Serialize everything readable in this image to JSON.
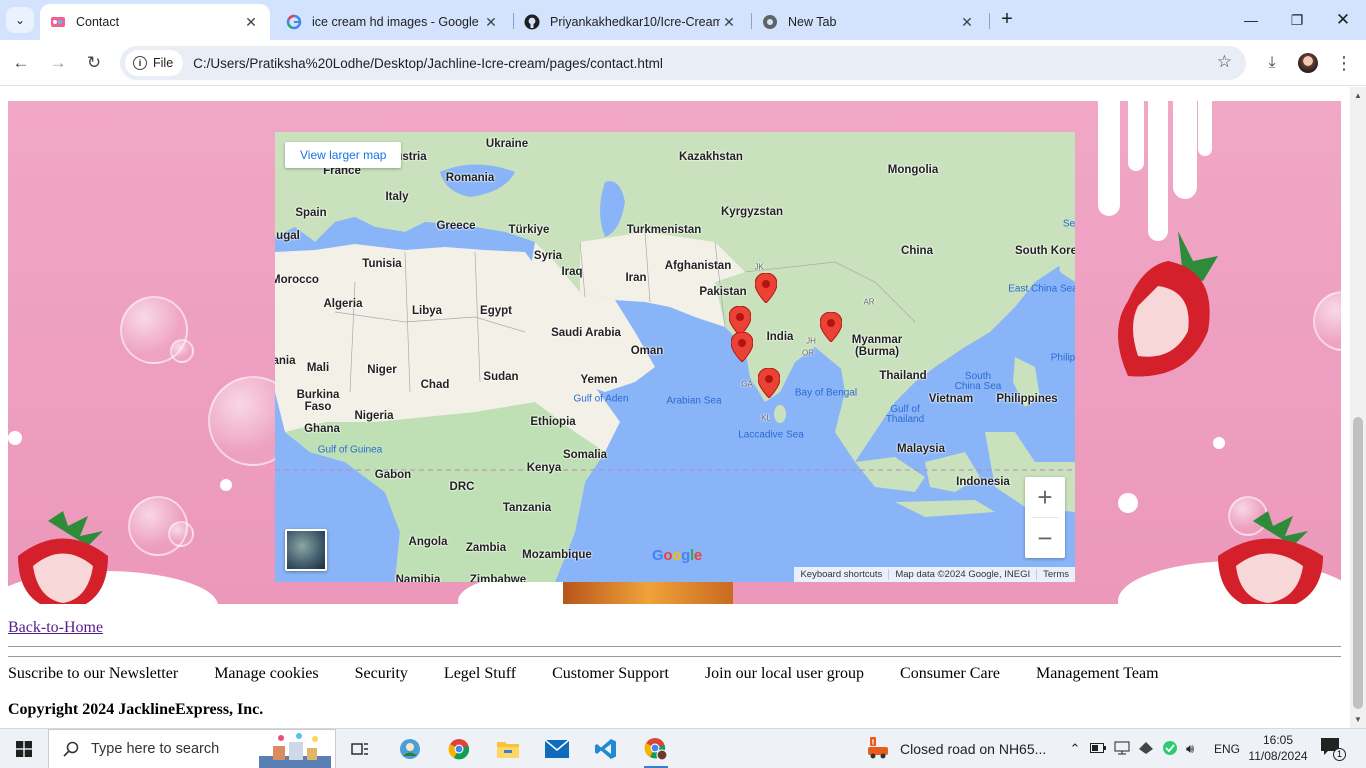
{
  "browser": {
    "tabs": [
      {
        "title": "Contact",
        "active": true
      },
      {
        "title": "ice cream hd images - Google S",
        "active": false
      },
      {
        "title": "Priyankakhedkar10/Icre-Cream",
        "active": false
      },
      {
        "title": "New Tab",
        "active": false
      }
    ],
    "file_chip": "File",
    "url": "C:/Users/Pratiksha%20Lodhe/Desktop/Jachline-Icre-cream/pages/contact.html"
  },
  "map": {
    "larger_map_label": "View larger map",
    "zoom_in": "+",
    "zoom_out": "−",
    "logo": "Google",
    "attribution": [
      "Keyboard shortcuts",
      "Map data ©2024 Google, INEGI",
      "Terms"
    ],
    "countries": [
      {
        "name": "Ukraine"
      },
      {
        "name": "Kazakhstan"
      },
      {
        "name": "Mongolia"
      },
      {
        "name": "Romania"
      },
      {
        "name": "France"
      },
      {
        "name": "Italy"
      },
      {
        "name": "Spain"
      },
      {
        "name": "Greece"
      },
      {
        "name": "Türkiye"
      },
      {
        "name": "Turkmenistan"
      },
      {
        "name": "Kyrgyzstan"
      },
      {
        "name": "China"
      },
      {
        "name": "South Kore"
      },
      {
        "name": "Tunisia"
      },
      {
        "name": "Syria"
      },
      {
        "name": "Iraq"
      },
      {
        "name": "Iran"
      },
      {
        "name": "Afghanistan"
      },
      {
        "name": "Pakistan"
      },
      {
        "name": "Morocco"
      },
      {
        "name": "Algeria"
      },
      {
        "name": "Libya"
      },
      {
        "name": "Egypt"
      },
      {
        "name": "Saudi Arabia"
      },
      {
        "name": "Oman"
      },
      {
        "name": "India"
      },
      {
        "name": "Myanmar\n(Burma)"
      },
      {
        "name": "Mali"
      },
      {
        "name": "Niger"
      },
      {
        "name": "Chad"
      },
      {
        "name": "Sudan"
      },
      {
        "name": "Yemen"
      },
      {
        "name": "Thailand"
      },
      {
        "name": "Burkina\nFaso"
      },
      {
        "name": "Nigeria"
      },
      {
        "name": "Ethiopia"
      },
      {
        "name": "Vietnam"
      },
      {
        "name": "Philippines"
      },
      {
        "name": "Ghana"
      },
      {
        "name": "Somalia"
      },
      {
        "name": "Malaysia"
      },
      {
        "name": "Kenya"
      },
      {
        "name": "Gabon"
      },
      {
        "name": "DRC"
      },
      {
        "name": "Indonesia"
      },
      {
        "name": "Tanzania"
      },
      {
        "name": "Angola"
      },
      {
        "name": "Zambia"
      },
      {
        "name": "Mozambique"
      },
      {
        "name": "ugal"
      },
      {
        "name": "ania"
      },
      {
        "name": "ustria"
      },
      {
        "name": "Namibia"
      },
      {
        "name": "Zimbabwe"
      }
    ],
    "water": [
      {
        "name": "Gulf of Aden"
      },
      {
        "name": "Arabian Sea"
      },
      {
        "name": "Bay of Bengal"
      },
      {
        "name": "Gulf of Guinea"
      },
      {
        "name": "Laccadive Sea"
      },
      {
        "name": "South\nChina Sea"
      },
      {
        "name": "Gulf of\nThailand"
      },
      {
        "name": "East China Sea"
      },
      {
        "name": "Philip"
      },
      {
        "name": "Se"
      }
    ],
    "regions": [
      {
        "name": "JK"
      },
      {
        "name": "JH"
      },
      {
        "name": "OR"
      },
      {
        "name": "AR"
      },
      {
        "name": "GA"
      },
      {
        "name": "KL"
      }
    ]
  },
  "page": {
    "back_link": "Back-to-Home",
    "footer_links": [
      "Suscribe to our Newsletter",
      "Manage cookies",
      "Security",
      "Legel Stuff",
      "Customer Support",
      "Join our local user group",
      "Consumer Care",
      "Management Team"
    ],
    "copyright": "Copyright 2024 JacklineExpress, Inc."
  },
  "taskbar": {
    "search_placeholder": "Type here to search",
    "weather": "Closed road on NH65...",
    "language": "ENG",
    "time": "16:05",
    "date": "11/08/2024",
    "notifications": "1"
  },
  "colors": {
    "banner_pink": "#ee9fc0",
    "map_water": "#8ab4f8",
    "map_land": "#f3f0e8",
    "map_green": "#bfe0b4",
    "pin_red": "#ea4335",
    "link_visited": "#551a8b"
  }
}
